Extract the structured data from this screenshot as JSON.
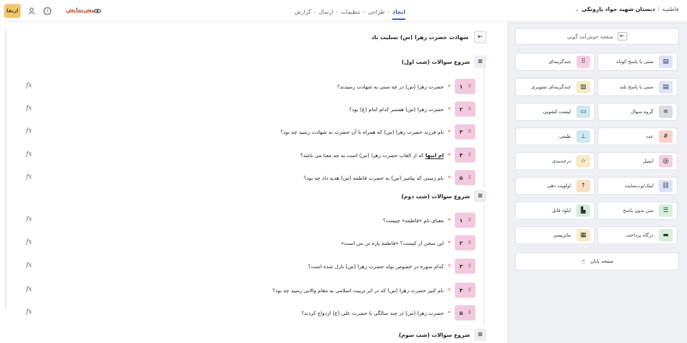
{
  "header": {
    "upgrade_label": "ارتقا",
    "preview_label": "پیش‌نمایش",
    "steps": [
      {
        "label": "ایجاد",
        "active": true
      },
      {
        "label": "طراحی",
        "active": false
      },
      {
        "label": "تنظیمات",
        "active": false
      },
      {
        "label": "ارسال",
        "active": false
      },
      {
        "label": "گزارش",
        "active": false
      }
    ],
    "breadcrumb_root": "فاطمیه",
    "breadcrumb_current": "دبستان شهید جواد پارونکی"
  },
  "welcome_page": {
    "title": "شهادت حضرت زهرا (س) تسلیت باد"
  },
  "groups": [
    {
      "title": "شروع سوالات (شب اول)",
      "questions": [
        {
          "num": "۱",
          "text": "حضرت زهرا (س) در چه سنی به شهادت رسیدند؟"
        },
        {
          "num": "۲",
          "text": "حضرت زهرا (س) همسر کدام امام (ع) بود؟"
        },
        {
          "num": "۳",
          "text": "نام فرزند حضرت زهرا (س) که همراه با آن حضرت به شهادت رسید چه بود؟"
        },
        {
          "num": "۴",
          "text_emph": "ام ابیها",
          "text": "که از القاب حضرت زهرا (س) است به چه معنا می باشد؟"
        },
        {
          "num": "۵",
          "text": "نام زمینی که پیامبر (ص) به حضرت فاطمه (س) هدیه داد چه بود؟"
        }
      ]
    },
    {
      "title": "شروع سوالات (شب دوم)",
      "questions": [
        {
          "num": "۱",
          "text": "معنای نام «فاطمه» چیست؟"
        },
        {
          "num": "۲",
          "text": "این سخن از کیست؟ «فاطمه پاره تن من است»"
        },
        {
          "num": "۳",
          "text": "کدام سوره در خصوص تولد حضرت زهرا (س) نازل شده است؟"
        },
        {
          "num": "۴",
          "text": "نام کنیز حضرت زهرا (س) که در اثر تربیت اسلامی به مقام والایی رسید چه بود؟"
        },
        {
          "num": "۵",
          "text": "حضرت زهرا (س) در چند سالگی با حضرت علی (ع) ازدواج کردند؟"
        }
      ]
    },
    {
      "title": "شروع سوالات (شب سوم)",
      "questions": []
    }
  ],
  "fx_label": "fx",
  "panel": {
    "welcome_add_label": "صفحه خوش‌آمد گویی",
    "tiles": [
      {
        "label": "متنی با پاسخ کوتاه",
        "icon": "▤",
        "color": "#dde3fb"
      },
      {
        "label": "چندگزینه‌ای",
        "icon": "⠿",
        "color": "#f6cfe4"
      },
      {
        "label": "متنی با پاسخ بلند",
        "icon": "▤",
        "color": "#dde3fb"
      },
      {
        "label": "چندگزینه‌ای تصویری",
        "icon": "▨",
        "color": "#f7ecc6"
      },
      {
        "label": "گروه سوال",
        "icon": "≡",
        "color": "#d9dce3"
      },
      {
        "label": "لیست کشویی",
        "icon": "▭",
        "color": "#cfe9f2"
      },
      {
        "label": "عدد",
        "icon": "#",
        "color": "#f9d3cc"
      },
      {
        "label": "طیفی",
        "icon": "⊥",
        "color": "#cfe9f2"
      },
      {
        "label": "ایمیل",
        "icon": "@",
        "color": "#f6cfe4"
      },
      {
        "label": "درجه‌بندی",
        "icon": "☆",
        "color": "#f7ecc6"
      },
      {
        "label": "لینک/وب‌سایت",
        "icon": "⛓",
        "color": "#dde3fb"
      },
      {
        "label": "اولویت دهی",
        "icon": "↑",
        "color": "#f9e0c4"
      },
      {
        "label": "متن بدون پاسخ",
        "icon": "☰",
        "color": "#d6efd9"
      },
      {
        "label": "اپلود فایل",
        "icon": "▙",
        "color": "#d6efd9"
      },
      {
        "label": "درگاه پرداخت",
        "icon": "▬",
        "color": "#d6efd9"
      },
      {
        "label": "ماتریسی",
        "icon": "▦",
        "color": "#f7ecc6"
      }
    ],
    "human_label": "صفحه پایان",
    "human_icon": "☝"
  },
  "colors": {
    "accent": "#3b52c4",
    "upgrade": "#f2c66a",
    "question_badge": "#f3c9e0",
    "panel_bg": "#eef0f4"
  }
}
